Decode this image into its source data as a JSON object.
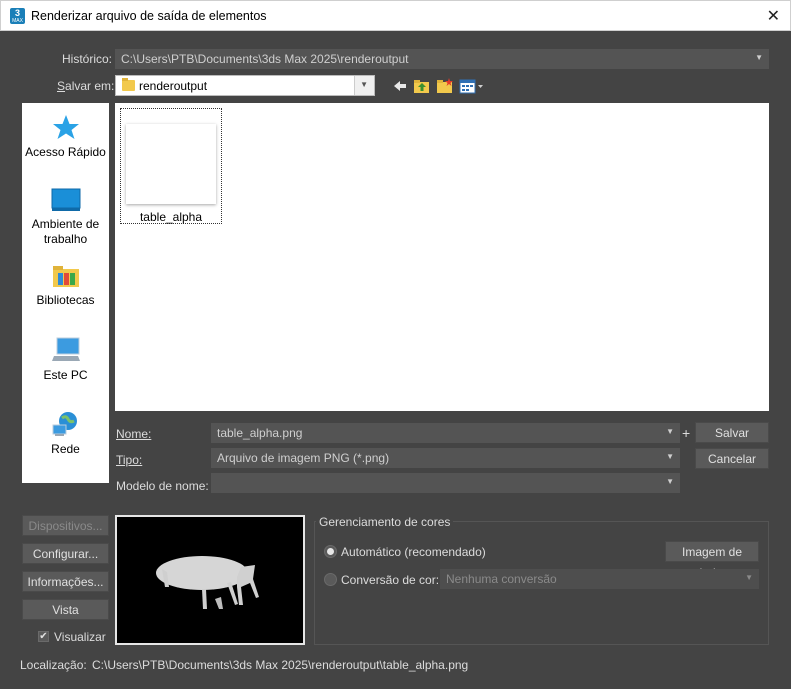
{
  "window": {
    "title": "Renderizar arquivo de saída de elementos",
    "app_icon_text": "3",
    "app_icon_sub": "MAX",
    "close_symbol": "✕"
  },
  "history": {
    "label": "Histórico:",
    "value": "C:\\Users\\PTB\\Documents\\3ds Max 2025\\renderoutput"
  },
  "save_in": {
    "label": "Salvar em:",
    "value": "renderoutput"
  },
  "toolbar": {
    "icons": [
      "back-arrow-icon",
      "up-folder-icon",
      "new-folder-icon",
      "view-menu-icon"
    ]
  },
  "places": [
    {
      "label": "Acesso Rápido",
      "icon": "star-icon"
    },
    {
      "label": "Ambiente de trabalho",
      "icon": "desktop-icon"
    },
    {
      "label": "Bibliotecas",
      "icon": "libraries-icon"
    },
    {
      "label": "Este PC",
      "icon": "computer-icon"
    },
    {
      "label": "Rede",
      "icon": "network-icon"
    }
  ],
  "files": [
    {
      "name": "table_alpha"
    }
  ],
  "fields": {
    "name_label": "Nome:",
    "name_value": "table_alpha.png",
    "plus": "+",
    "type_label": "Tipo:",
    "type_value": "Arquivo de imagem PNG (*.png)",
    "template_label": "Modelo de nome:",
    "template_value": ""
  },
  "buttons": {
    "save": "Salvar",
    "cancel": "Cancelar",
    "devices": "Dispositivos...",
    "setup": "Configurar...",
    "info": "Informações...",
    "view": "Vista"
  },
  "show_checkbox": {
    "label": "Visualizar",
    "checked": true,
    "mark": "✔"
  },
  "color_management": {
    "title": "Gerenciamento de cores",
    "automatic": "Automático (recomendado)",
    "data_image": "Imagem de dados",
    "conversion_label": "Conversão de cor:",
    "conversion_value": "Nenhuma conversão"
  },
  "location": {
    "label": "Localização:",
    "value": "C:\\Users\\PTB\\Documents\\3ds Max 2025\\renderoutput\\table_alpha.png"
  },
  "colors": {
    "background": "#444444",
    "panel": "#ffffff",
    "field": "#545454",
    "button": "#5a5a5a"
  }
}
